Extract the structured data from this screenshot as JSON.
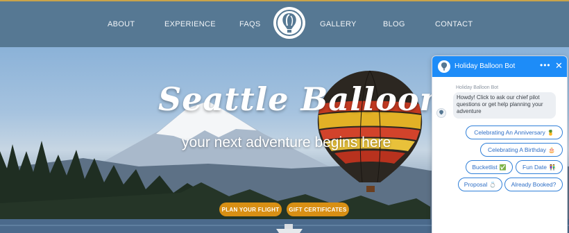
{
  "nav": {
    "items": [
      {
        "label": "ABOUT"
      },
      {
        "label": "EXPERIENCE"
      },
      {
        "label": "FAQS"
      },
      {
        "label": "GALLERY"
      },
      {
        "label": "BLOG"
      },
      {
        "label": "CONTACT"
      }
    ],
    "logo_icon": "balloon-logo-icon"
  },
  "hero": {
    "title": "Seattle Ballooning",
    "subtitle": "your next adventure begins here",
    "cta_primary": "PLAN YOUR FLIGHT",
    "cta_secondary": "GIFT CERTIFICATES",
    "accent_color": "#d88f14"
  },
  "chat": {
    "title": "Holiday Balloon Bot",
    "header_color": "#1d8cf8",
    "more_label": "•••",
    "close_label": "✕",
    "bot_name": "Holiday Balloon Bot",
    "message": "Howdy! Click to ask our chief pilot questions or get help planning your adventure",
    "options": [
      {
        "label": "Celebrating An Anniversary",
        "emoji": "🍍"
      },
      {
        "label": "Celebrating A Birthday",
        "emoji": "🎂"
      },
      {
        "label": "Bucketlist",
        "emoji": "✅"
      },
      {
        "label": "Fun Date",
        "emoji": "👫"
      },
      {
        "label": "Proposal",
        "emoji": "💍"
      },
      {
        "label": "Already Booked?",
        "emoji": ""
      }
    ]
  }
}
